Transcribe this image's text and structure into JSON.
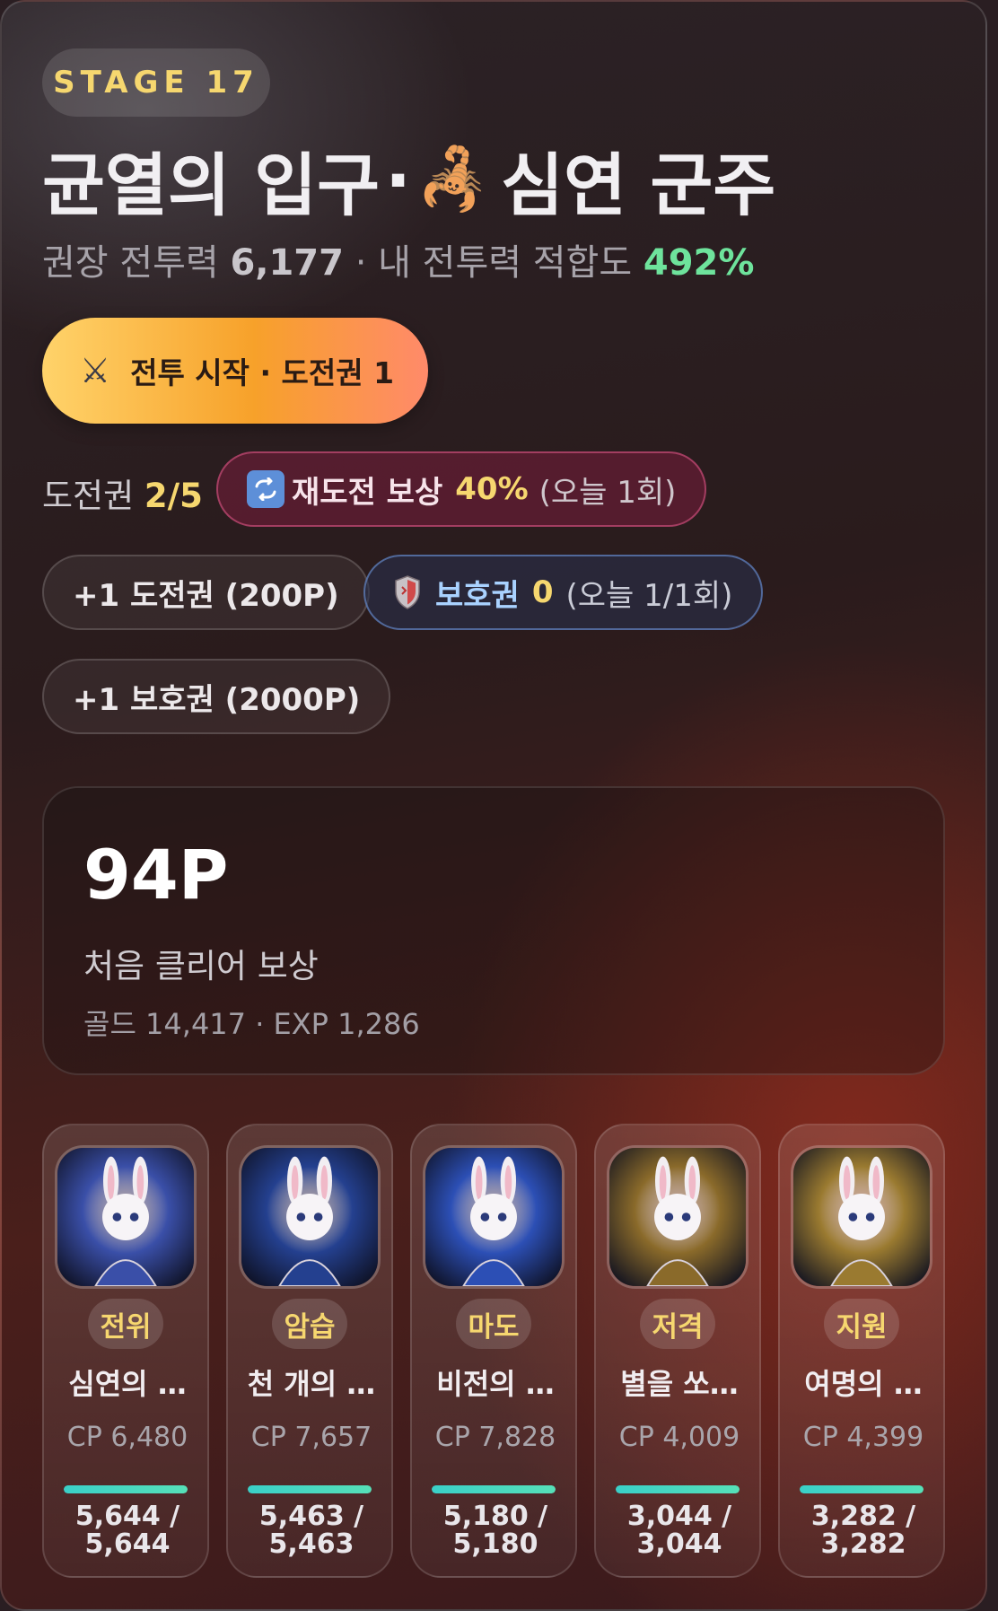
{
  "stage": {
    "label": "STAGE 17"
  },
  "header": {
    "title_main": "균열의 입구",
    "title_sep": "·",
    "title_icon": "scorpion-icon",
    "title_icon_glyph": "🦂",
    "title_boss": "심연 군주"
  },
  "power": {
    "rec_label": "권장 전투력",
    "rec_value": "6,177",
    "sep": "·",
    "fit_label": "내 전투력 적합도",
    "fit_value": "492%"
  },
  "battle": {
    "icon": "crossed-swords-icon",
    "icon_glyph": "⚔",
    "label": "전투 시작 · 도전권 1"
  },
  "tickets": {
    "label": "도전권",
    "value": "2/5"
  },
  "retry": {
    "icon": "repeat-icon",
    "icon_glyph": "🔁",
    "label": "재도전 보상",
    "pct": "40%",
    "note": "(오늘 1회)"
  },
  "buy_ticket": {
    "label": "+1 도전권 (200P)"
  },
  "shield": {
    "icon": "shield-icon",
    "label": "보호권",
    "value": "0",
    "note": "(오늘 1/1회)"
  },
  "buy_shield": {
    "label": "+1 보호권 (2000P)"
  },
  "reward": {
    "points": "94P",
    "label": "처음 클리어 보상",
    "detail": "골드 14,417 · EXP 1,286"
  },
  "heroes": [
    {
      "role": "전위",
      "name": "심연의 …",
      "cp": "CP 6,480",
      "hp_line1": "5,644 /",
      "hp_line2": "5,644",
      "hp_fraction": 1.0,
      "theme": "#3a4fa8"
    },
    {
      "role": "암습",
      "name": "천 개의 …",
      "cp": "CP 7,657",
      "hp_line1": "5,463 /",
      "hp_line2": "5,463",
      "hp_fraction": 1.0,
      "theme": "#24408f"
    },
    {
      "role": "마도",
      "name": "비전의 …",
      "cp": "CP 7,828",
      "hp_line1": "5,180 /",
      "hp_line2": "5,180",
      "hp_fraction": 1.0,
      "theme": "#2c4fb5"
    },
    {
      "role": "저격",
      "name": "별을 쏘…",
      "cp": "CP 4,009",
      "hp_line1": "3,044 /",
      "hp_line2": "3,044",
      "hp_fraction": 1.0,
      "theme": "#8a6a2a"
    },
    {
      "role": "지원",
      "name": "여명의 …",
      "cp": "CP 4,399",
      "hp_line1": "3,282 /",
      "hp_line2": "3,282",
      "hp_fraction": 1.0,
      "theme": "#9a7a30"
    }
  ],
  "colors": {
    "accent_gold": "#f6d76f",
    "fit_green": "#6ee39c",
    "hp_bar": "#3ad0c8"
  }
}
